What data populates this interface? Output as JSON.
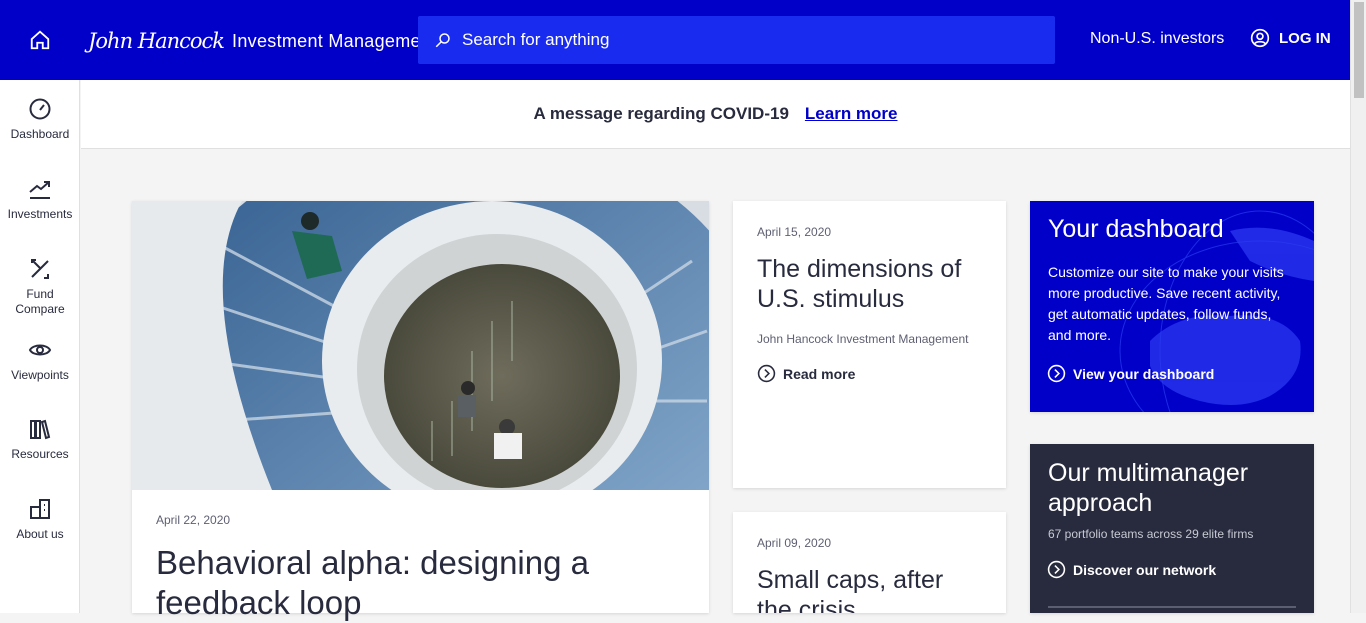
{
  "header": {
    "logo_script": "John Hancock",
    "logo_text": "Investment Management",
    "search_placeholder": "Search for anything",
    "non_us": "Non-U.S. investors",
    "login": "LOG IN"
  },
  "sidebar": {
    "items": [
      {
        "label": "Dashboard",
        "icon": "gauge-icon"
      },
      {
        "label": "Investments",
        "icon": "trend-up-icon"
      },
      {
        "label": "Fund Compare",
        "icon": "compare-arrows-icon"
      },
      {
        "label": "Viewpoints",
        "icon": "eye-icon"
      },
      {
        "label": "Resources",
        "icon": "books-icon"
      },
      {
        "label": "About us",
        "icon": "building-icon"
      }
    ]
  },
  "banner": {
    "message": "A message regarding COVID-19",
    "link": "Learn more"
  },
  "articles": {
    "featured": {
      "date": "April 22, 2020",
      "title": "Behavioral alpha: designing a feedback loop"
    },
    "card1": {
      "date": "April 15, 2020",
      "title": "The dimensions of U.S. stimulus",
      "author": "John Hancock Investment Management",
      "cta": "Read more"
    },
    "card2": {
      "date": "April 09, 2020",
      "title": "Small caps, after the crisis"
    }
  },
  "promos": {
    "dashboard": {
      "title": "Your dashboard",
      "body": "Customize our site to make your visits more productive. Save recent activity, get automatic updates, follow funds, and more.",
      "cta": "View your dashboard"
    },
    "multimanager": {
      "title": "Our multimanager approach",
      "subtitle": "67 portfolio teams across 29 elite firms",
      "cta": "Discover our network"
    }
  },
  "colors": {
    "brand_blue": "#0000c9",
    "navy": "#282b3e"
  }
}
